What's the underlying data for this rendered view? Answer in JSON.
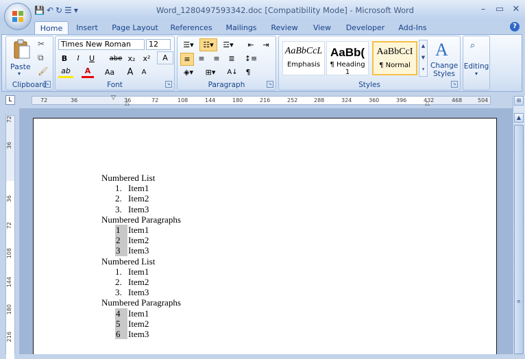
{
  "window": {
    "title": "Word_1280497593342.doc [Compatibility Mode] - Microsoft Word",
    "minimize": "–",
    "maximize": "▭",
    "close": "✕"
  },
  "qat": {
    "save": "💾",
    "undo": "↶",
    "redo": "↻",
    "bullets": "☰",
    "customize": "▾"
  },
  "tabs": [
    "Home",
    "Insert",
    "Page Layout",
    "References",
    "Mailings",
    "Review",
    "View",
    "Developer",
    "Add-Ins"
  ],
  "active_tab": "Home",
  "help": "?",
  "ribbon": {
    "clipboard": {
      "label": "Clipboard",
      "paste": "Paste"
    },
    "font": {
      "label": "Font",
      "font_name": "Times New Roman",
      "font_size": "12",
      "bold": "B",
      "italic": "I",
      "underline": "U",
      "strike": "abe",
      "subscript": "x₂",
      "superscript": "x²",
      "clear": "A",
      "highlight": "ab",
      "font_color": "A",
      "change_case": "Aa",
      "grow": "A",
      "shrink": "A"
    },
    "paragraph": {
      "label": "Paragraph",
      "sort": "A↓",
      "show_marks": "¶"
    },
    "styles": {
      "label": "Styles",
      "items": [
        {
          "sample": "AaBbCcL",
          "name": "Emphasis",
          "selected": false
        },
        {
          "sample": "AaBb(",
          "name": "¶ Heading 1",
          "selected": false
        },
        {
          "sample": "AaBbCcI",
          "name": "¶ Normal",
          "selected": true
        }
      ],
      "change_styles": "Change Styles"
    },
    "editing": {
      "label": "Editing"
    }
  },
  "ruler": {
    "h_ticks": [
      "72",
      "36",
      "36",
      "72",
      "108",
      "144",
      "180",
      "216",
      "252",
      "288",
      "324",
      "360",
      "396",
      "432",
      "468",
      "504"
    ],
    "v_ticks": [
      "72",
      "36",
      "36",
      "72",
      "108",
      "144",
      "180",
      "216"
    ]
  },
  "document": {
    "lines": [
      {
        "num": "",
        "text": "Numbered List",
        "shaded": false,
        "indent": false
      },
      {
        "num": "1.",
        "text": "Item1",
        "shaded": false,
        "indent": true
      },
      {
        "num": "2.",
        "text": "Item2",
        "shaded": false,
        "indent": true
      },
      {
        "num": "3.",
        "text": "Item3",
        "shaded": false,
        "indent": true
      },
      {
        "num": "",
        "text": "Numbered Paragraphs",
        "shaded": false,
        "indent": false
      },
      {
        "num": "1",
        "text": "Item1",
        "shaded": true,
        "indent": true
      },
      {
        "num": "2",
        "text": "Item2",
        "shaded": true,
        "indent": true
      },
      {
        "num": "3",
        "text": "Item3",
        "shaded": true,
        "indent": true
      },
      {
        "num": "",
        "text": "Numbered List",
        "shaded": false,
        "indent": false
      },
      {
        "num": "1.",
        "text": "Item1",
        "shaded": false,
        "indent": true
      },
      {
        "num": "2.",
        "text": "Item2",
        "shaded": false,
        "indent": true
      },
      {
        "num": "3.",
        "text": "Item3",
        "shaded": false,
        "indent": true
      },
      {
        "num": "",
        "text": "Numbered Paragraphs",
        "shaded": false,
        "indent": false
      },
      {
        "num": "4",
        "text": "Item1",
        "shaded": true,
        "indent": true
      },
      {
        "num": "5",
        "text": "Item2",
        "shaded": true,
        "indent": true
      },
      {
        "num": "6",
        "text": "Item3",
        "shaded": true,
        "indent": true
      }
    ]
  },
  "scrollbar": {
    "up": "▲",
    "ruler_toggle": "⊞"
  }
}
